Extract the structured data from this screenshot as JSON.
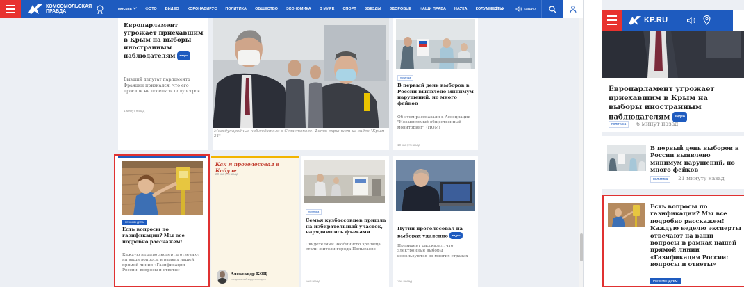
{
  "desktop": {
    "brand": "Комсомольская правда",
    "region_label": "москва",
    "nav": [
      "ФОТО",
      "ВИДЕО",
      "КОРОНАВИРУС",
      "ПОЛИТИКА",
      "ОБЩЕСТВО",
      "ЭКОНОМИКА",
      "В МИРЕ",
      "СПОРТ",
      "ЗВЕЗДЫ",
      "ЗДОРОВЬЕ",
      "НАШИ ПРАВА",
      "НАУКА",
      "КОЛУМНИСТЫ"
    ],
    "more_label": "ЕЩЁ",
    "radio_label": "радио",
    "story1": {
      "title": "Европарламент угрожает приехавшим в Крым на выборы иностранным наблюдателям",
      "badge": "видео",
      "lead": "Бывший депутат парламента Франции признался, что его просили не посещать полуостров",
      "time": "1 минут назад"
    },
    "hero": {
      "caption": "Международные наблюдатели в Севастополе. Фото: скриншот из видео \"Крым 24\""
    },
    "story2": {
      "tag": "политика",
      "title": "В первый день выборов в России выявлено минимум нарушений, но много фейков",
      "lead": "Об этом рассказали в Ассоциации \"Независимый общественный мониторинг\" (НОМ)",
      "time": "10 минут назад"
    },
    "story3": {
      "tag": "рекомендуем",
      "title": "Есть вопросы по газификации? Мы все подробно расскажем!",
      "lead": "Каждую неделю эксперты отвечают на ваши вопросы в рамках нашей прямой линии «Газификация России: вопросы и ответы»"
    },
    "story4": {
      "title": "Как я проголосовал в Кабуле",
      "time": "20 минут назад",
      "author": "Александр КОЦ",
      "author_role": "специальный корреспондент"
    },
    "story5": {
      "tag": "политика",
      "title": "Семья кузбассовцев пришла на избирательный участок, нарядившись фъеками",
      "lead": "Свидетелями необычного зрелища стали жители города Полысаево",
      "time": "час назад"
    },
    "story6": {
      "title": "Путин проголосовал на выборах удаленно",
      "badge": "видео",
      "lead": "Президент рассказал, что электронные выборы используются во многих странах",
      "time": "час назад"
    }
  },
  "mobile": {
    "brand": "KP.RU",
    "story1": {
      "title": "Европарламент угрожает приехавшим в Крым на выборы иностранным наблюдателям",
      "badge": "видео",
      "tag": "политика",
      "time": "6 минут назад"
    },
    "story2": {
      "title": "В первый день выборов в России выявлено минимум нарушений, но много фейков",
      "tag": "политика",
      "time": "21 минуту назад"
    },
    "story3": {
      "title": "Есть вопросы по газификации? Мы все подробно расскажем! Каждую неделю эксперты отвечают на ваши вопросы в рамках нашей прямой линии «Газификация России: вопросы и ответы»",
      "tag": "рекомендуем"
    }
  },
  "colors": {
    "brand_blue": "#1e5bbf",
    "menu_red": "#e8322f",
    "highlight_red": "#e03131",
    "author_link": "#c0392b"
  },
  "icons": [
    "menu-icon",
    "kp-bird-logo-icon",
    "chevron-down-icon",
    "radio-icon",
    "search-icon",
    "user-icon",
    "pin-icon"
  ]
}
